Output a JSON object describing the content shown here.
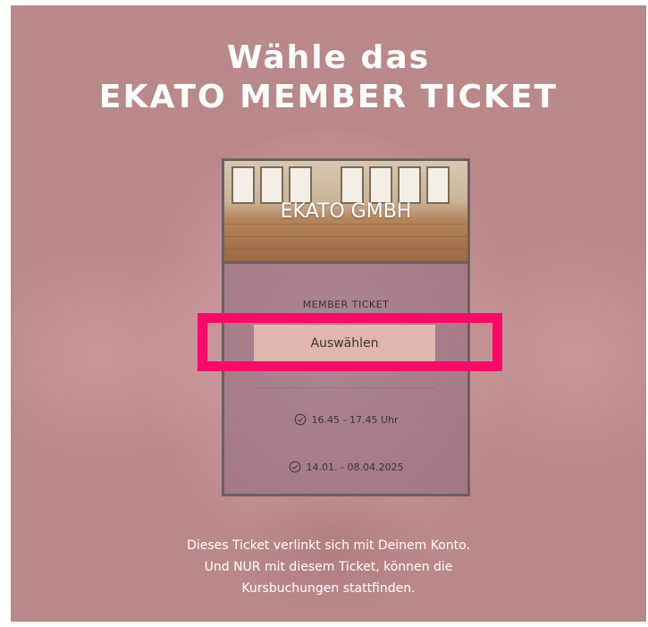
{
  "header": {
    "title_line1": "Wähle das",
    "title_line2": "EKATO MEMBER TICKET"
  },
  "card": {
    "image_label": "EKATO GMBH",
    "ticket_type": "MEMBER TICKET",
    "select_button_label": "Auswählen",
    "time_range": "16.45 - 17.45 Uhr",
    "date_range": "14.01. - 08.04.2025"
  },
  "footer": {
    "line1": "Dieses Ticket verlinkt sich mit Deinem Konto.",
    "line2": "Und NUR mit diesem Ticket, können die",
    "line3": "Kursbuchungen stattfinden."
  },
  "colors": {
    "background": "#b9888a",
    "button": "#dfb7ae",
    "highlight": "#ff0868",
    "card_border": "#6a6062"
  },
  "icons": {
    "time": "check-circle-icon",
    "date": "check-circle-icon"
  }
}
